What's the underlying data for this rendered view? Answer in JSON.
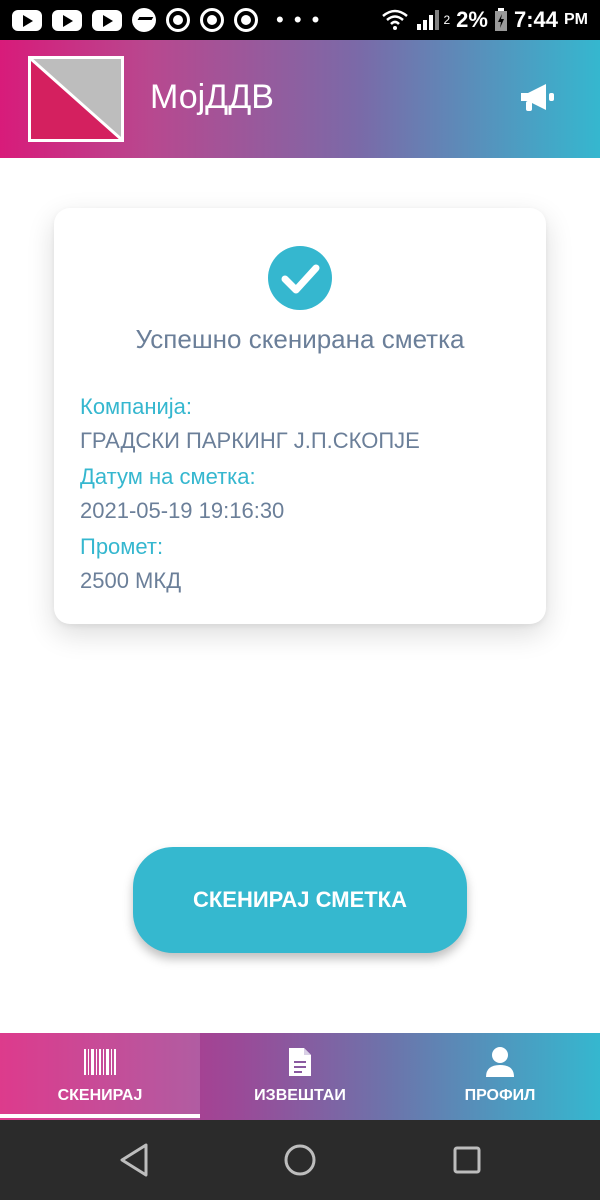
{
  "status_bar": {
    "battery": "2%",
    "time": "7:44",
    "ampm": "PM",
    "signal_sub": "2",
    "more": "• • •"
  },
  "app_bar": {
    "title": "МојДДВ"
  },
  "receipt": {
    "title": "Успешно скенирана сметка",
    "company_label": "Компанија:",
    "company_value": "ГРАДСКИ ПАРКИНГ Ј.П.СКОПЈЕ",
    "date_label": "Датум на сметка:",
    "date_value": "2021-05-19 19:16:30",
    "amount_label": "Промет:",
    "amount_value": "2500 МКД"
  },
  "actions": {
    "scan_label": "СКЕНИРАЈ СМЕТКА"
  },
  "bottom_nav": {
    "items": [
      {
        "label": "СКЕНИРАЈ",
        "icon": "barcode-icon",
        "active": true
      },
      {
        "label": "ИЗВЕШТАИ",
        "icon": "document-icon",
        "active": false
      },
      {
        "label": "ПРОФИЛ",
        "icon": "person-icon",
        "active": false
      }
    ]
  },
  "colors": {
    "brand_pink": "#d81b7a",
    "brand_cyan": "#35b7cf",
    "text_gray": "#6b7f99"
  }
}
